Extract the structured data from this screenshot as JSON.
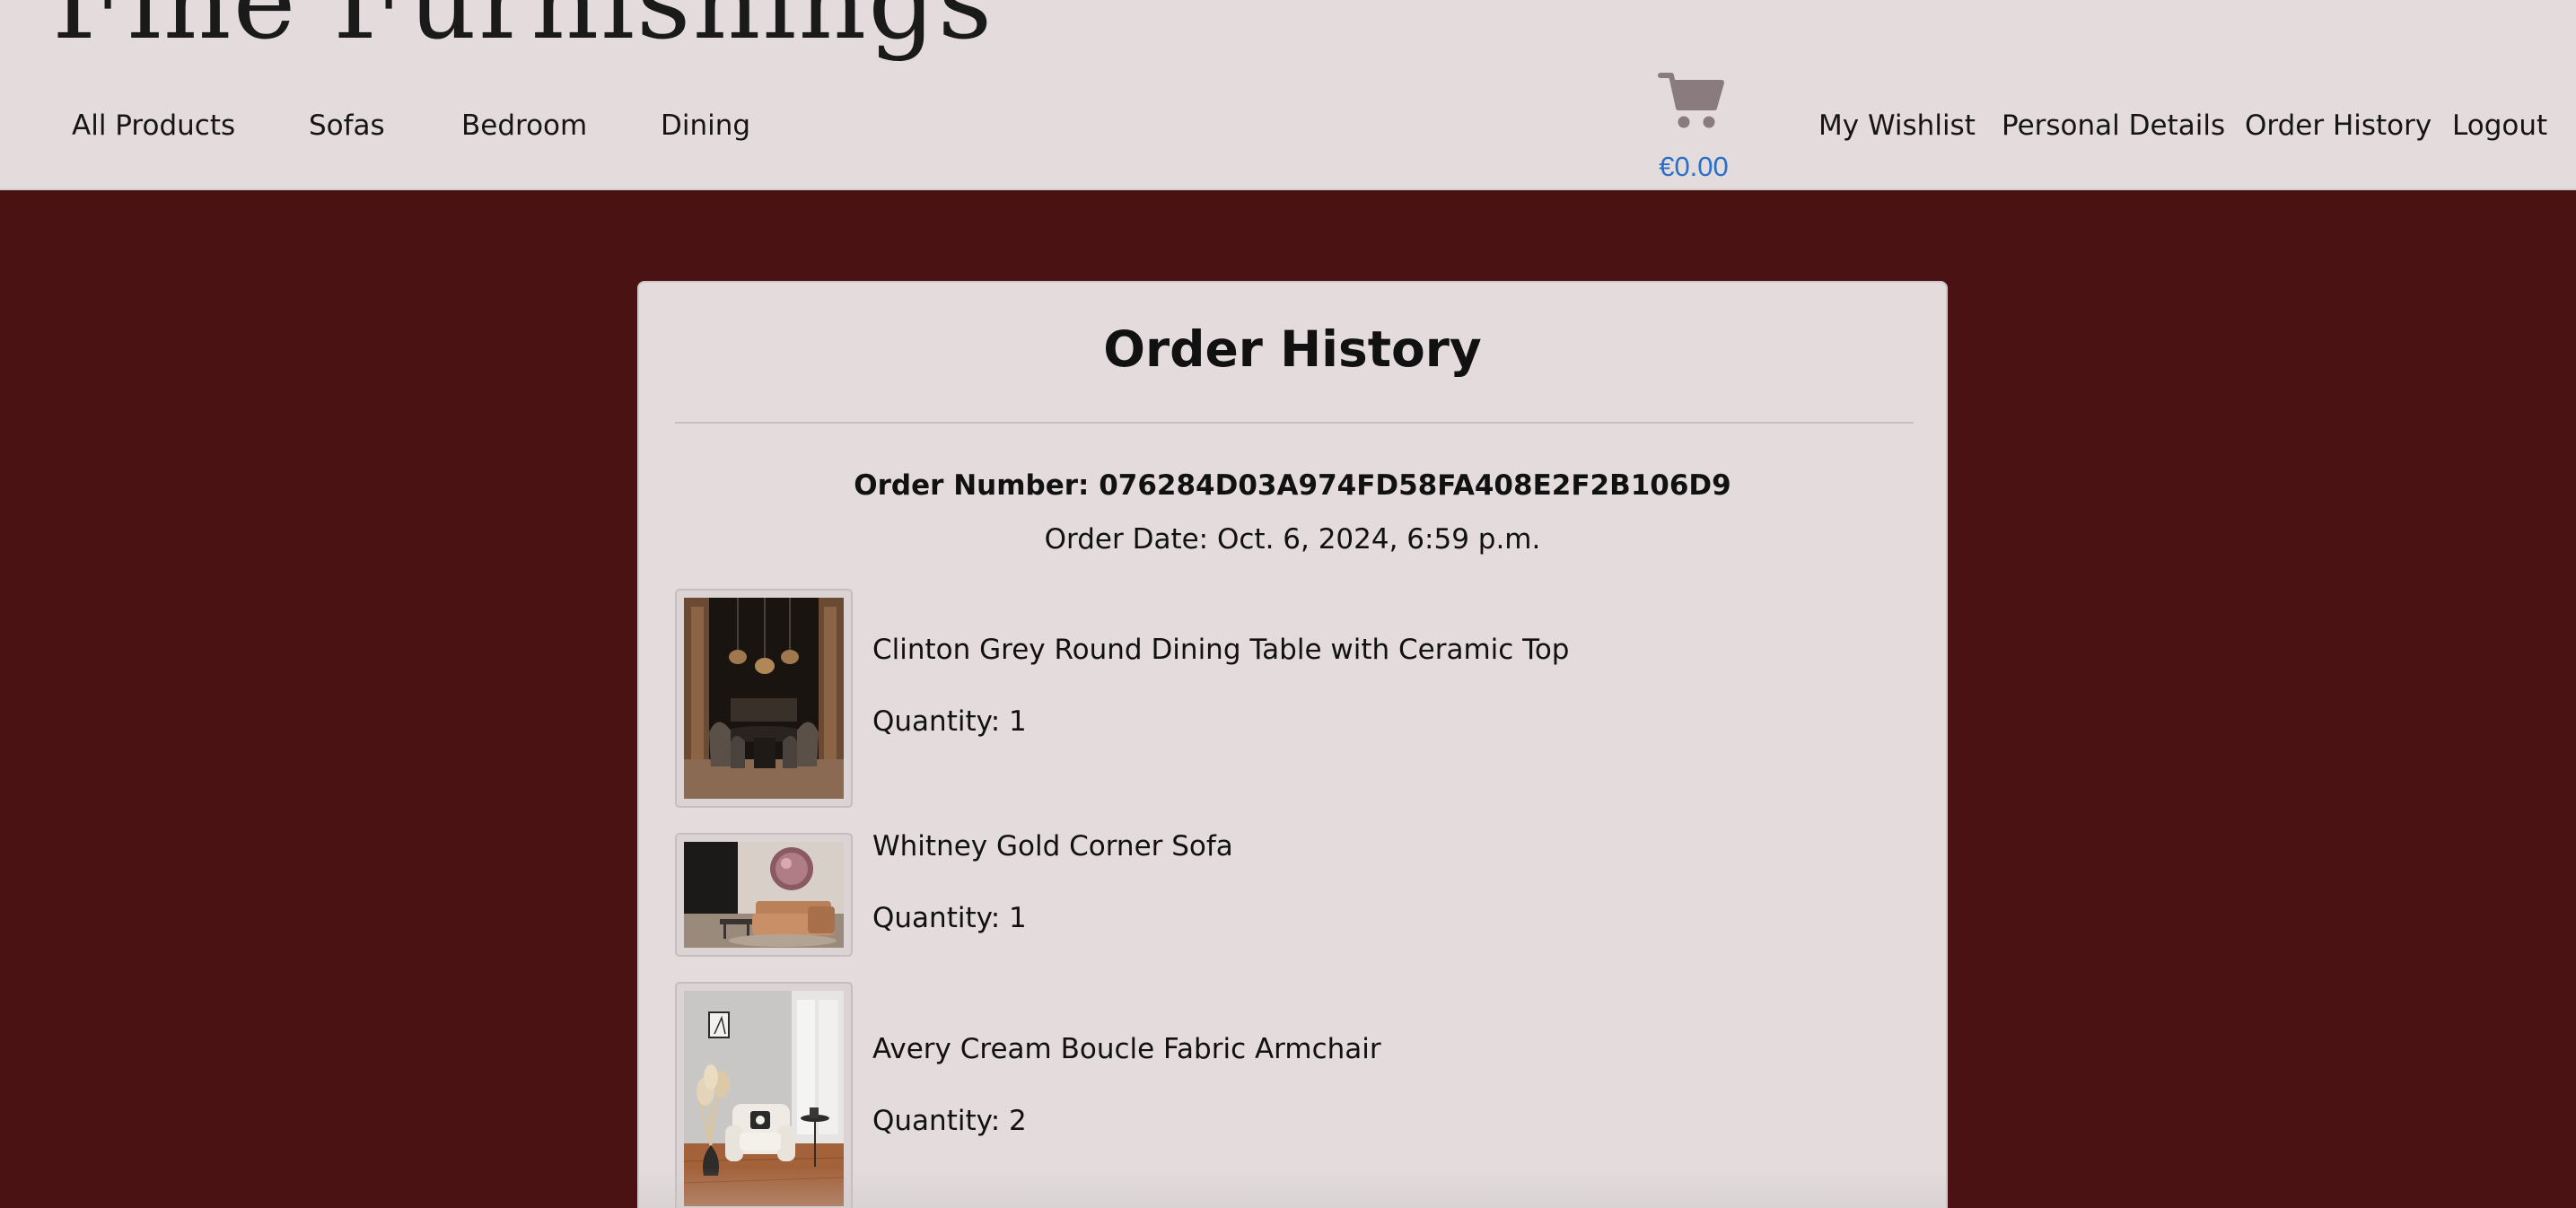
{
  "brand": {
    "name": "Fine Furnishings"
  },
  "nav": {
    "left": [
      {
        "label": "All Products"
      },
      {
        "label": "Sofas"
      },
      {
        "label": "Bedroom"
      },
      {
        "label": "Dining"
      }
    ],
    "right": [
      {
        "label": "My Wishlist"
      },
      {
        "label": "Personal Details"
      },
      {
        "label": "Order History"
      },
      {
        "label": "Logout"
      }
    ]
  },
  "cart": {
    "icon": "shopping-cart-icon",
    "total": "€0.00",
    "total_color": "#2a6fc9"
  },
  "colors": {
    "page_background": "#4a1213",
    "header_background": "#e3dbdc",
    "card_background": "#e3dbdc"
  },
  "order": {
    "title": "Order History",
    "number_text": "Order Number: 076284D03A974FD58FA408E2F2B106D9",
    "date_text": "Order Date: Oct. 6, 2024, 6:59 p.m.",
    "items": [
      {
        "name": "Clinton Grey Round Dining Table with Ceramic Top",
        "quantity_text": "Quantity: 1",
        "image": "dining-table-photo"
      },
      {
        "name": "Whitney Gold Corner Sofa",
        "quantity_text": "Quantity: 1",
        "image": "corner-sofa-photo"
      },
      {
        "name": "Avery Cream Boucle Fabric Armchair",
        "quantity_text": "Quantity: 2",
        "image": "armchair-photo"
      }
    ]
  }
}
